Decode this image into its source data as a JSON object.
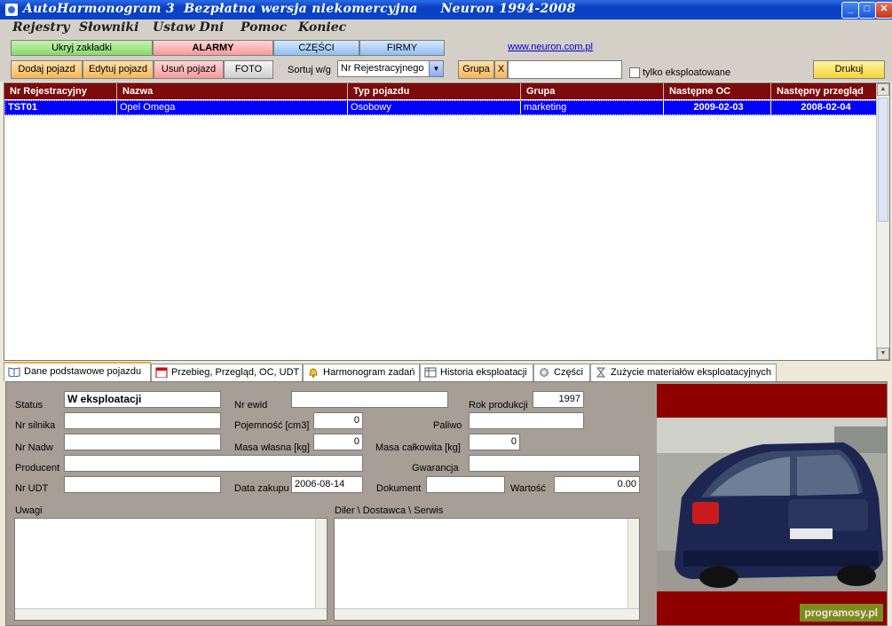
{
  "window": {
    "title": "AutoHarmonogram 3  Bezpłatna wersja niekomercyjna     Neuron 1994-2008"
  },
  "menu": [
    "Rejestry",
    "Słowniki",
    "Ustaw Dni",
    "Pomoc",
    "Koniec"
  ],
  "toolbar1": {
    "hide_tabs": "Ukryj zakładki",
    "alarms": "ALARMY",
    "parts": "CZĘŚCI",
    "companies": "FIRMY",
    "link": "www.neuron.com.pl"
  },
  "toolbar2": {
    "add": "Dodaj pojazd",
    "edit": "Edytuj pojazd",
    "delete": "Usuń pojazd",
    "photo": "FOTO",
    "sort_label": "Sortuj w/g",
    "sort_value": "Nr Rejestracyjnego",
    "group_btn": "Grupa",
    "group_clear": "X",
    "group_value": "",
    "only_active": "tylko eksploatowane",
    "print": "Drukuj"
  },
  "table": {
    "columns": [
      "Nr Rejestracyjny",
      "Nazwa",
      "Typ pojazdu",
      "Grupa",
      "Następne OC",
      "Następny przegląd"
    ],
    "rows": [
      [
        "TST01",
        "Opel Omega",
        "Osobowy",
        "marketing",
        "2009-02-03",
        "2008-02-04"
      ]
    ]
  },
  "tabs": [
    "Dane podstawowe pojazdu",
    "Przebieg, Przegląd, OC, UDT",
    "Harmonogram zadań",
    "Historia eksploatacji",
    "Części",
    "Zużycie materiałów eksploatacyjnych"
  ],
  "form": {
    "status_label": "Status",
    "status_value": "W eksploatacji",
    "nr_ewid_label": "Nr ewid",
    "nr_ewid_value": "",
    "rok_label": "Rok produkcji",
    "rok_value": "1997",
    "nr_silnika_label": "Nr silnika",
    "nr_silnika_value": "",
    "pojemnosc_label": "Pojemność [cm3]",
    "pojemnosc_value": "0",
    "paliwo_label": "Paliwo",
    "paliwo_value": "",
    "nr_nadw_label": "Nr Nadw",
    "nr_nadw_value": "",
    "masa_wlasna_label": "Masa własna [kg]",
    "masa_wlasna_value": "0",
    "masa_calk_label": "Masa całkowita [kg]",
    "masa_calk_value": "0",
    "producent_label": "Producent",
    "producent_value": "",
    "gwarancja_label": "Gwarancja",
    "gwarancja_value": "",
    "nr_udt_label": "Nr UDT",
    "nr_udt_value": "",
    "data_zakupu_label": "Data zakupu",
    "data_zakupu_value": "2006-08-14",
    "dokument_label": "Dokument",
    "dokument_value": "",
    "wartosc_label": "Wartość",
    "wartosc_value": "0.00",
    "uwagi_label": "Uwagi",
    "diler_label": "Diler \\ Dostawca \\ Serwis"
  },
  "photo": {
    "watermark": "programosy.pl"
  }
}
